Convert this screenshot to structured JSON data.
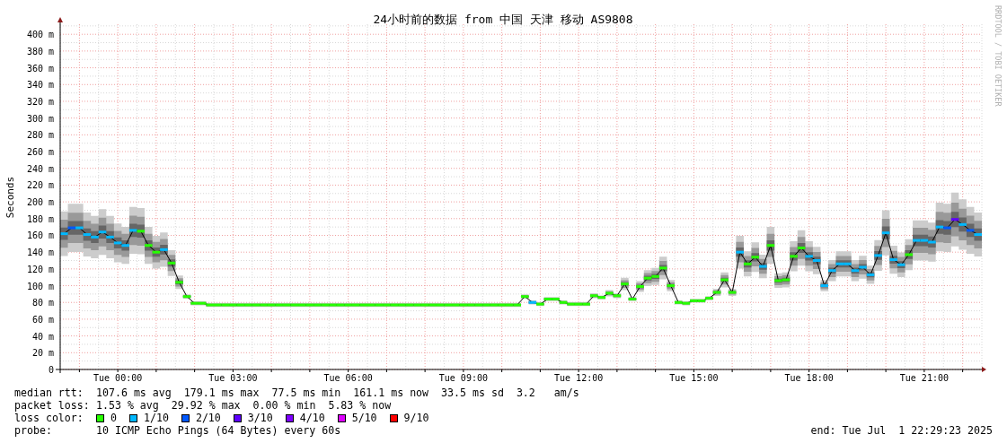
{
  "credit": "RRDTOOL / TOBI OETIKER",
  "chart_data": {
    "type": "line",
    "grid": true,
    "title": "24小时前的数据 from 中国 天津 移动 AS9808",
    "ylabel": "Seconds",
    "ylim": [
      0,
      412
    ],
    "categories": [
      null,
      null,
      null,
      null,
      null,
      null,
      null,
      "Tue 00:00",
      null,
      null,
      null,
      null,
      null,
      null,
      null,
      null,
      null,
      null,
      null,
      null,
      null,
      null,
      "Tue 03:00",
      null,
      null,
      null,
      null,
      null,
      null,
      null,
      null,
      null,
      null,
      null,
      null,
      null,
      null,
      "Tue 06:00",
      null,
      null,
      null,
      null,
      null,
      null,
      null,
      null,
      null,
      null,
      null,
      null,
      null,
      null,
      "Tue 09:00",
      null,
      null,
      null,
      null,
      null,
      null,
      null,
      null,
      null,
      null,
      null,
      null,
      null,
      null,
      "Tue 12:00",
      null,
      null,
      null,
      null,
      null,
      null,
      null,
      null,
      null,
      null,
      null,
      null,
      null,
      null,
      "Tue 15:00",
      null,
      null,
      null,
      null,
      null,
      null,
      null,
      null,
      null,
      null,
      null,
      null,
      null,
      null,
      "Tue 18:00",
      null,
      null,
      null,
      null,
      null,
      null,
      null,
      null,
      null,
      null,
      null,
      null,
      null,
      null,
      "Tue 21:00",
      null,
      null,
      null,
      null,
      null,
      null,
      null
    ],
    "yticks": [
      {
        "value": 0,
        "label": "0"
      },
      {
        "value": 20,
        "label": "20 m"
      },
      {
        "value": 40,
        "label": "40 m"
      },
      {
        "value": 60,
        "label": "60 m"
      },
      {
        "value": 80,
        "label": "80 m"
      },
      {
        "value": 100,
        "label": "100 m"
      },
      {
        "value": 120,
        "label": "120 m"
      },
      {
        "value": 140,
        "label": "140 m"
      },
      {
        "value": 160,
        "label": "160 m"
      },
      {
        "value": 180,
        "label": "180 m"
      },
      {
        "value": 200,
        "label": "200 m"
      },
      {
        "value": 220,
        "label": "220 m"
      },
      {
        "value": 240,
        "label": "240 m"
      },
      {
        "value": 260,
        "label": "260 m"
      },
      {
        "value": 280,
        "label": "280 m"
      },
      {
        "value": 300,
        "label": "300 m"
      },
      {
        "value": 320,
        "label": "320 m"
      },
      {
        "value": 340,
        "label": "340 m"
      },
      {
        "value": 360,
        "label": "360 m"
      },
      {
        "value": 380,
        "label": "380 m"
      },
      {
        "value": 400,
        "label": "400 m"
      }
    ],
    "series": [
      {
        "color": "#000000",
        "marker": "square",
        "values": [
          162,
          169,
          169,
          161,
          158,
          164,
          158,
          151,
          148,
          166,
          165,
          148,
          140,
          143,
          127,
          104,
          87,
          79,
          79,
          77,
          77,
          77,
          77,
          77,
          77,
          77,
          77,
          77,
          77,
          77,
          77,
          77,
          77,
          77,
          77,
          77,
          77,
          77,
          77,
          77,
          77,
          77,
          77,
          77,
          77,
          77,
          77,
          77,
          77,
          77,
          77,
          77,
          77,
          77,
          77,
          77,
          77,
          77,
          77,
          77,
          87,
          80,
          78,
          84,
          84,
          80,
          78,
          78,
          78,
          88,
          86,
          91,
          88,
          102,
          84,
          99,
          109,
          111,
          121,
          100,
          80,
          79,
          82,
          82,
          85,
          92,
          107,
          92,
          140,
          126,
          134,
          123,
          148,
          106,
          107,
          135,
          145,
          135,
          130,
          100,
          118,
          126,
          126,
          118,
          122,
          113,
          136,
          163,
          131,
          125,
          137,
          154,
          154,
          152,
          170,
          169,
          179,
          173,
          166,
          161
        ]
      }
    ]
  },
  "loss_marks": [
    {
      "color": "#00b8ff"
    },
    {
      "color": "#0059ff"
    },
    {
      "color": "#00b8ff"
    },
    {
      "color": "#00b8ff"
    },
    {
      "color": "#00b8ff"
    },
    {
      "color": "#00b8ff"
    },
    {
      "color": "#00b8ff"
    },
    {
      "color": "#00b8ff"
    },
    {
      "color": "#00b8ff"
    },
    {
      "color": "#00b8ff"
    },
    {
      "color": "#26ff00"
    },
    {
      "color": "#26ff00"
    },
    {
      "color": "#26ff00"
    },
    {
      "color": "#00b8ff"
    },
    {
      "color": "#26ff00"
    },
    {
      "color": "#26ff00"
    },
    {
      "color": "#26ff00"
    },
    {
      "color": "#26ff00"
    },
    {
      "color": "#26ff00"
    },
    {
      "color": "#26ff00"
    },
    {
      "color": "#26ff00"
    },
    {
      "color": "#26ff00"
    },
    {
      "color": "#26ff00"
    },
    {
      "color": "#26ff00"
    },
    {
      "color": "#26ff00"
    },
    {
      "color": "#26ff00"
    },
    {
      "color": "#26ff00"
    },
    {
      "color": "#26ff00"
    },
    {
      "color": "#26ff00"
    },
    {
      "color": "#26ff00"
    },
    {
      "color": "#26ff00"
    },
    {
      "color": "#26ff00"
    },
    {
      "color": "#26ff00"
    },
    {
      "color": "#26ff00"
    },
    {
      "color": "#26ff00"
    },
    {
      "color": "#26ff00"
    },
    {
      "color": "#26ff00"
    },
    {
      "color": "#26ff00"
    },
    {
      "color": "#26ff00"
    },
    {
      "color": "#26ff00"
    },
    {
      "color": "#26ff00"
    },
    {
      "color": "#26ff00"
    },
    {
      "color": "#26ff00"
    },
    {
      "color": "#26ff00"
    },
    {
      "color": "#26ff00"
    },
    {
      "color": "#26ff00"
    },
    {
      "color": "#26ff00"
    },
    {
      "color": "#26ff00"
    },
    {
      "color": "#26ff00"
    },
    {
      "color": "#26ff00"
    },
    {
      "color": "#26ff00"
    },
    {
      "color": "#26ff00"
    },
    {
      "color": "#26ff00"
    },
    {
      "color": "#26ff00"
    },
    {
      "color": "#26ff00"
    },
    {
      "color": "#26ff00"
    },
    {
      "color": "#26ff00"
    },
    {
      "color": "#26ff00"
    },
    {
      "color": "#26ff00"
    },
    {
      "color": "#26ff00"
    },
    {
      "color": "#26ff00"
    },
    {
      "color": "#00b8ff"
    },
    {
      "color": "#26ff00"
    },
    {
      "color": "#26ff00"
    },
    {
      "color": "#26ff00"
    },
    {
      "color": "#26ff00"
    },
    {
      "color": "#26ff00"
    },
    {
      "color": "#26ff00"
    },
    {
      "color": "#26ff00"
    },
    {
      "color": "#26ff00"
    },
    {
      "color": "#26ff00"
    },
    {
      "color": "#26ff00"
    },
    {
      "color": "#26ff00"
    },
    {
      "color": "#26ff00"
    },
    {
      "color": "#26ff00"
    },
    {
      "color": "#26ff00"
    },
    {
      "color": "#26ff00"
    },
    {
      "color": "#26ff00"
    },
    {
      "color": "#26ff00"
    },
    {
      "color": "#26ff00"
    },
    {
      "color": "#26ff00"
    },
    {
      "color": "#26ff00"
    },
    {
      "color": "#26ff00"
    },
    {
      "color": "#26ff00"
    },
    {
      "color": "#26ff00"
    },
    {
      "color": "#26ff00"
    },
    {
      "color": "#26ff00"
    },
    {
      "color": "#26ff00"
    },
    {
      "color": "#00b8ff"
    },
    {
      "color": "#26ff00"
    },
    {
      "color": "#26ff00"
    },
    {
      "color": "#00b8ff"
    },
    {
      "color": "#26ff00"
    },
    {
      "color": "#26ff00"
    },
    {
      "color": "#26ff00"
    },
    {
      "color": "#26ff00"
    },
    {
      "color": "#26ff00"
    },
    {
      "color": "#00b8ff"
    },
    {
      "color": "#00b8ff"
    },
    {
      "color": "#00b8ff"
    },
    {
      "color": "#00b8ff"
    },
    {
      "color": "#00b8ff"
    },
    {
      "color": "#00b8ff"
    },
    {
      "color": "#00b8ff"
    },
    {
      "color": "#00b8ff"
    },
    {
      "color": "#00b8ff"
    },
    {
      "color": "#00b8ff"
    },
    {
      "color": "#00b8ff"
    },
    {
      "color": "#00b8ff"
    },
    {
      "color": "#00b8ff"
    },
    {
      "color": "#26ff00"
    },
    {
      "color": "#00b8ff"
    },
    {
      "color": "#00b8ff"
    },
    {
      "color": "#00b8ff"
    },
    {
      "color": "#00b8ff"
    },
    {
      "color": "#0059ff"
    },
    {
      "color": "#5e00ff"
    },
    {
      "color": "#00b8ff"
    },
    {
      "color": "#0059ff"
    },
    {
      "color": "#00b8ff"
    }
  ],
  "median_rtt": {
    "label": "median rtt:",
    "values": [
      "107.6 ms avg",
      "179.1 ms max",
      "77.5 ms min",
      "161.1 ms now",
      "33.5 ms sd",
      "3.2   am/s"
    ]
  },
  "packet_loss": {
    "label": "packet loss:",
    "values": [
      "1.53 % avg",
      "29.92 % max",
      "0.00 % min",
      "5.83 % now"
    ]
  },
  "loss_color": {
    "label": "loss color:",
    "items": [
      {
        "label": "0",
        "color": "#26ff00"
      },
      {
        "label": "1/10",
        "color": "#00b8ff"
      },
      {
        "label": "2/10",
        "color": "#0059ff"
      },
      {
        "label": "3/10",
        "color": "#5e00ff"
      },
      {
        "label": "4/10",
        "color": "#7e00ff"
      },
      {
        "label": "5/10",
        "color": "#dd00ff"
      },
      {
        "label": "9/10",
        "color": "#ff0000"
      }
    ]
  },
  "probe": {
    "label": "probe:",
    "value": "10 ICMP Echo Pings (64 Bytes) every 60s"
  },
  "end": "end: Tue Jul  1 22:29:23 2025"
}
